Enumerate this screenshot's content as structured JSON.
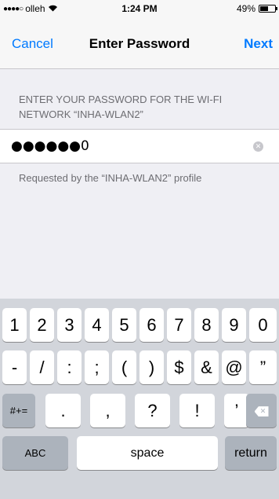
{
  "status_bar": {
    "signal": "●●●●○",
    "carrier": "olleh",
    "time": "1:24 PM",
    "battery_percent": "49%",
    "battery_level": 0.49
  },
  "nav": {
    "cancel_label": "Cancel",
    "title": "Enter Password",
    "next_label": "Next"
  },
  "form": {
    "header": "ENTER YOUR PASSWORD FOR THE WI-FI NETWORK “INHA-WLAN2”",
    "password_value": "●●●●●●0",
    "footer": "Requested by the “INHA-WLAN2” profile"
  },
  "keyboard": {
    "row1": [
      "1",
      "2",
      "3",
      "4",
      "5",
      "6",
      "7",
      "8",
      "9",
      "0"
    ],
    "row2": [
      "-",
      "/",
      ":",
      ";",
      "(",
      ")",
      "$",
      "&",
      "@",
      "”"
    ],
    "row3_left": "#+=",
    "row3": [
      ".",
      ",",
      "?",
      "!",
      "’"
    ],
    "abc_label": "ABC",
    "space_label": "space",
    "return_label": "return"
  }
}
